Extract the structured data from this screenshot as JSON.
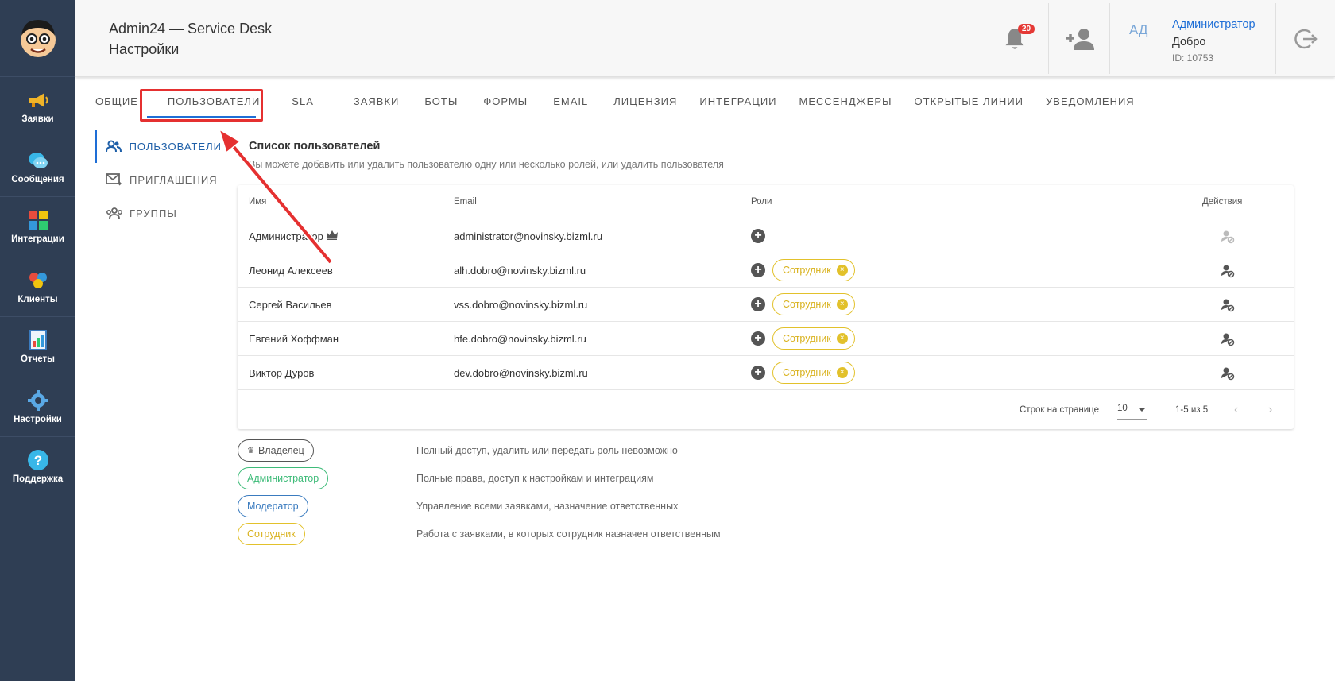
{
  "header": {
    "app_title": "Admin24 — Service Desk",
    "page_subtitle": "Настройки",
    "notifications_count": "20",
    "user": {
      "initials": "АД",
      "name": "Администратор",
      "org": "Добро",
      "id_text": "ID: 10753"
    }
  },
  "sidebar": {
    "items": [
      {
        "label": "Заявки",
        "icon": "megaphone-icon"
      },
      {
        "label": "Сообщения",
        "icon": "chat-bubbles-icon"
      },
      {
        "label": "Интеграции",
        "icon": "puzzle-icon"
      },
      {
        "label": "Клиенты",
        "icon": "clients-icon"
      },
      {
        "label": "Отчеты",
        "icon": "report-icon"
      },
      {
        "label": "Настройки",
        "icon": "gear-icon"
      },
      {
        "label": "Поддержка",
        "icon": "help-icon"
      }
    ]
  },
  "tabs": [
    "ОБЩИЕ",
    "ПОЛЬЗОВАТЕЛИ",
    "SLA",
    "ЗАЯВКИ",
    "БОТЫ",
    "ФОРМЫ",
    "EMAIL",
    "ЛИЦЕНЗИЯ",
    "ИНТЕГРАЦИИ",
    "МЕССЕНДЖЕРЫ",
    "ОТКРЫТЫЕ ЛИНИИ",
    "УВЕДОМЛЕНИЯ"
  ],
  "subnav": [
    "ПОЛЬЗОВАТЕЛИ",
    "ПРИГЛАШЕНИЯ",
    "ГРУППЫ"
  ],
  "users_section": {
    "title": "Список пользователей",
    "description": "Вы можете добавить или удалить пользователю одну или несколько ролей, или удалить пользователя"
  },
  "table": {
    "headers": {
      "name": "Имя",
      "email": "Email",
      "roles": "Роли",
      "actions": "Действия"
    },
    "rows": [
      {
        "name": "Администратор",
        "email": "administrator@novinsky.bizml.ru",
        "role": ""
      },
      {
        "name": "Леонид Алексеев",
        "email": "alh.dobro@novinsky.bizml.ru",
        "role": "Сотрудник"
      },
      {
        "name": "Сергей Васильев",
        "email": "vss.dobro@novinsky.bizml.ru",
        "role": "Сотрудник"
      },
      {
        "name": "Евгений Хоффман",
        "email": "hfe.dobro@novinsky.bizml.ru",
        "role": "Сотрудник"
      },
      {
        "name": "Виктор Дуров",
        "email": "dev.dobro@novinsky.bizml.ru",
        "role": "Сотрудник"
      }
    ],
    "footer": {
      "rows_per_page_label": "Строк на странице",
      "rows_per_page_value": "10",
      "range": "1-5 из 5"
    }
  },
  "legend": [
    {
      "role": "Владелец",
      "color": "#555555",
      "desc": "Полный доступ, удалить или передать роль невозможно"
    },
    {
      "role": "Администратор",
      "color": "#3dbb78",
      "desc": "Полные права, доступ к настройкам и интеграциям"
    },
    {
      "role": "Модератор",
      "color": "#3a7bbf",
      "desc": "Управление всеми заявками, назначение ответственных"
    },
    {
      "role": "Сотрудник",
      "color": "#d9b21e",
      "desc": "Работа с заявками, в которых сотрудник назначен ответственным"
    }
  ],
  "colors": {
    "sidebar": "#2f3e54",
    "accent": "#1e6ed6",
    "highlight": "#e53030"
  }
}
